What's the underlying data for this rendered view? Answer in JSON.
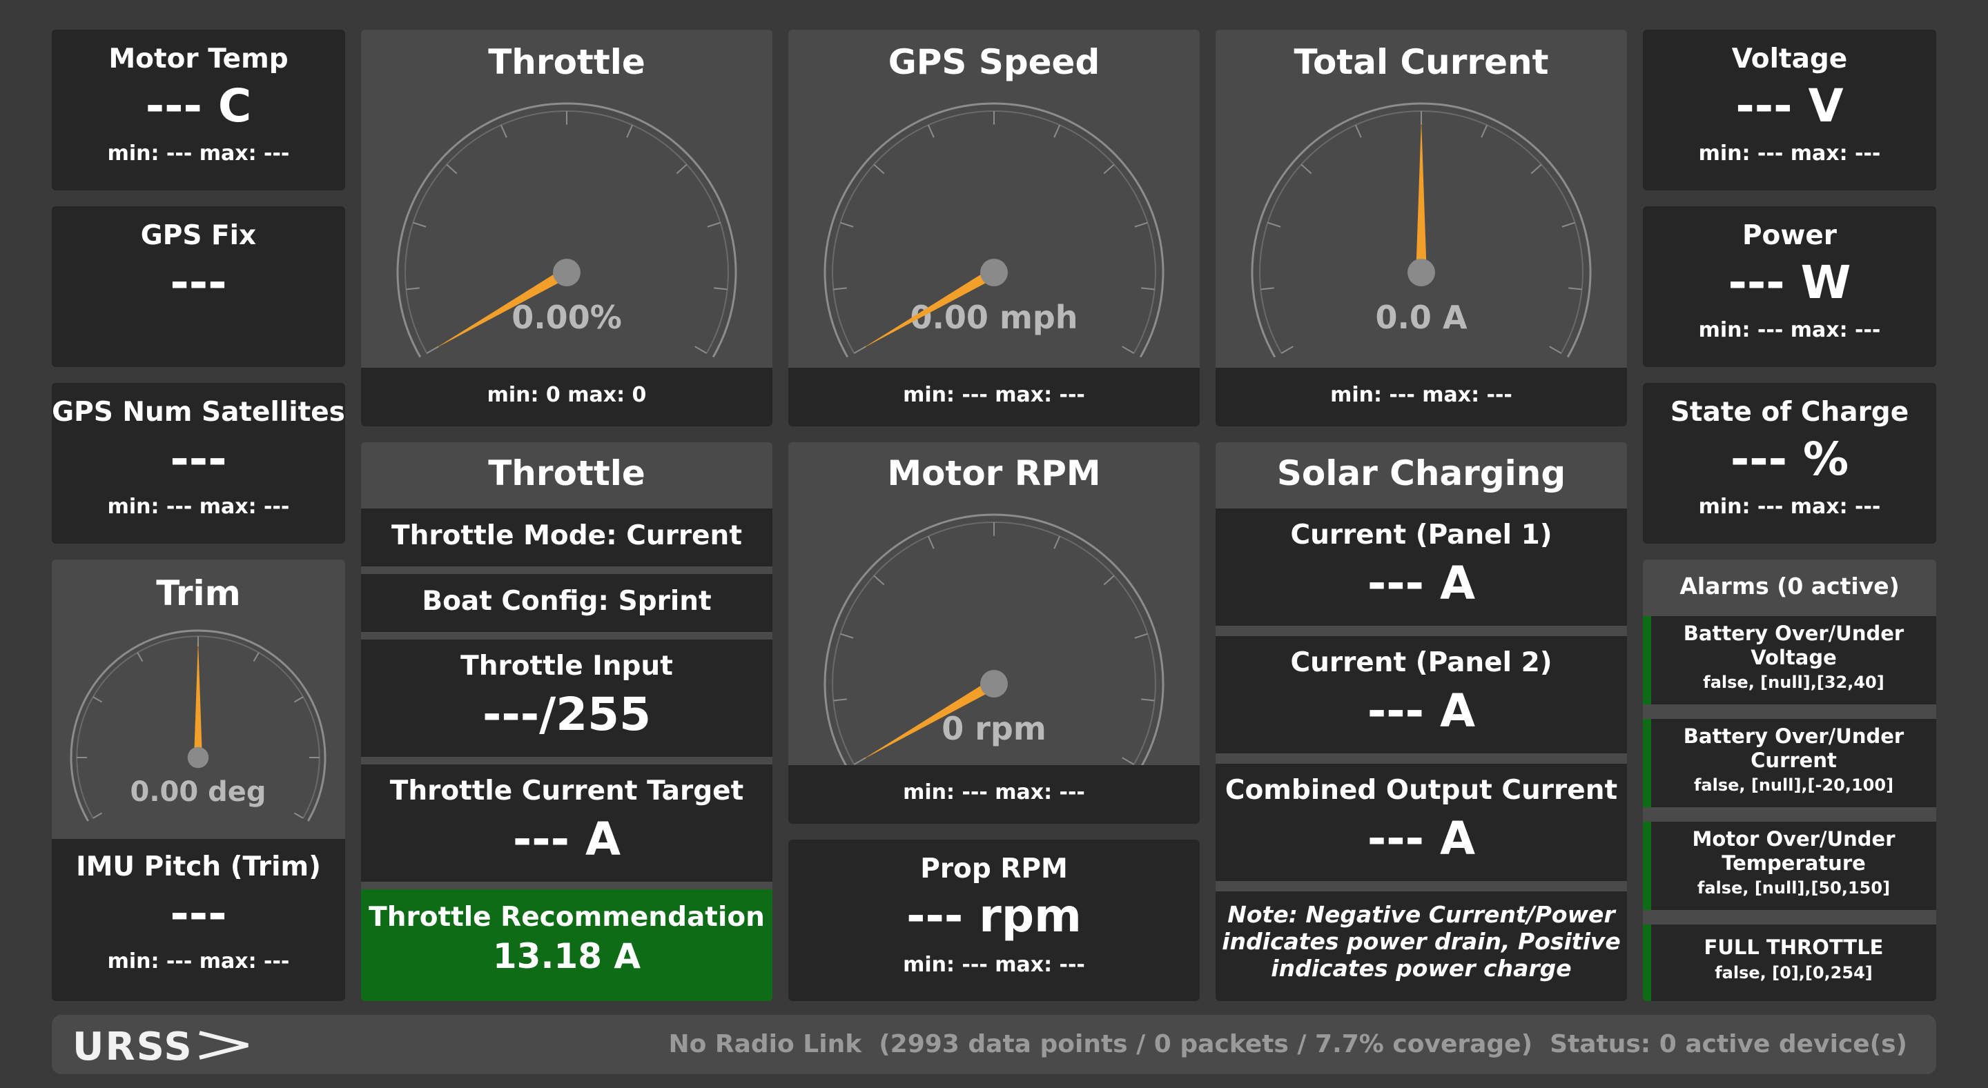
{
  "colors": {
    "background": "#3a3a3a",
    "card": "#262626",
    "card_light": "#4a4a4a",
    "needle": "#f2a02a",
    "ok_green": "#0e6b16"
  },
  "left": {
    "motor_temp": {
      "title": "Motor Temp",
      "value": "--- C",
      "minmax": "min: --- max: ---"
    },
    "gps_fix": {
      "title": "GPS Fix",
      "value": "---"
    },
    "gps_sats": {
      "title": "GPS Num Satellites",
      "value": "---",
      "minmax": "min: --- max: ---"
    },
    "trim": {
      "title": "Trim",
      "gauge_text": "0.00 deg",
      "needle_fraction": 0.5,
      "sub_title": "IMU Pitch (Trim)",
      "value": "---",
      "minmax": "min: --- max: ---"
    }
  },
  "gauges": {
    "throttle": {
      "title": "Throttle",
      "gauge_text": "0.00%",
      "needle_fraction": 0.0,
      "minmax": "min: 0 max: 0"
    },
    "gps_speed": {
      "title": "GPS Speed",
      "gauge_text": "0.00 mph",
      "needle_fraction": 0.0,
      "minmax": "min: --- max: ---"
    },
    "total_current": {
      "title": "Total Current",
      "gauge_text": "0.0 A",
      "needle_fraction": 0.5,
      "minmax": "min: --- max: ---"
    },
    "motor_rpm": {
      "title": "Motor RPM",
      "gauge_text": "0 rpm",
      "needle_fraction": 0.0,
      "minmax": "min: --- max: ---"
    }
  },
  "throttle_panel": {
    "title": "Throttle",
    "mode": "Throttle Mode: Current",
    "boat_config": "Boat Config: Sprint",
    "input_label": "Throttle Input",
    "input_value": "---/255",
    "target_label": "Throttle Current Target",
    "target_value": "--- A",
    "recommendation_label": "Throttle Recommendation",
    "recommendation_value": "13.18 A"
  },
  "prop_rpm": {
    "title": "Prop RPM",
    "value": "--- rpm",
    "minmax": "min: --- max: ---"
  },
  "solar": {
    "title": "Solar Charging",
    "panel1_label": "Current (Panel 1)",
    "panel1_value": "--- A",
    "panel2_label": "Current (Panel 2)",
    "panel2_value": "--- A",
    "combined_label": "Combined Output Current",
    "combined_value": "--- A",
    "note_line1": "Note: Negative Current/Power",
    "note_line2": "indicates power drain, Positive",
    "note_line3": "indicates power charge"
  },
  "right": {
    "voltage": {
      "title": "Voltage",
      "value": "--- V",
      "minmax": "min: --- max: ---"
    },
    "power": {
      "title": "Power",
      "value": "--- W",
      "minmax": "min: --- max: ---"
    },
    "soc": {
      "title": "State of Charge",
      "value": "--- %",
      "minmax": "min: --- max: ---"
    }
  },
  "alarms": {
    "title": "Alarms (0 active)",
    "items": [
      {
        "line1": "Battery Over/Under",
        "line2": "Voltage",
        "detail": "false, [null],[32,40]"
      },
      {
        "line1": "Battery Over/Under",
        "line2": "Current",
        "detail": "false, [null],[-20,100]"
      },
      {
        "line1": "Motor Over/Under",
        "line2": "Temperature",
        "detail": "false, [null],[50,150]"
      },
      {
        "line1": "FULL THROTTLE",
        "line2": "",
        "detail": "false, [0],[0,254]"
      }
    ]
  },
  "footer": {
    "logo": "URSS",
    "logo_icon": "chevron-right-icon",
    "status": "No Radio Link  (2993 data points / 0 packets / 7.7% coverage)  Status: 0 active device(s)"
  }
}
